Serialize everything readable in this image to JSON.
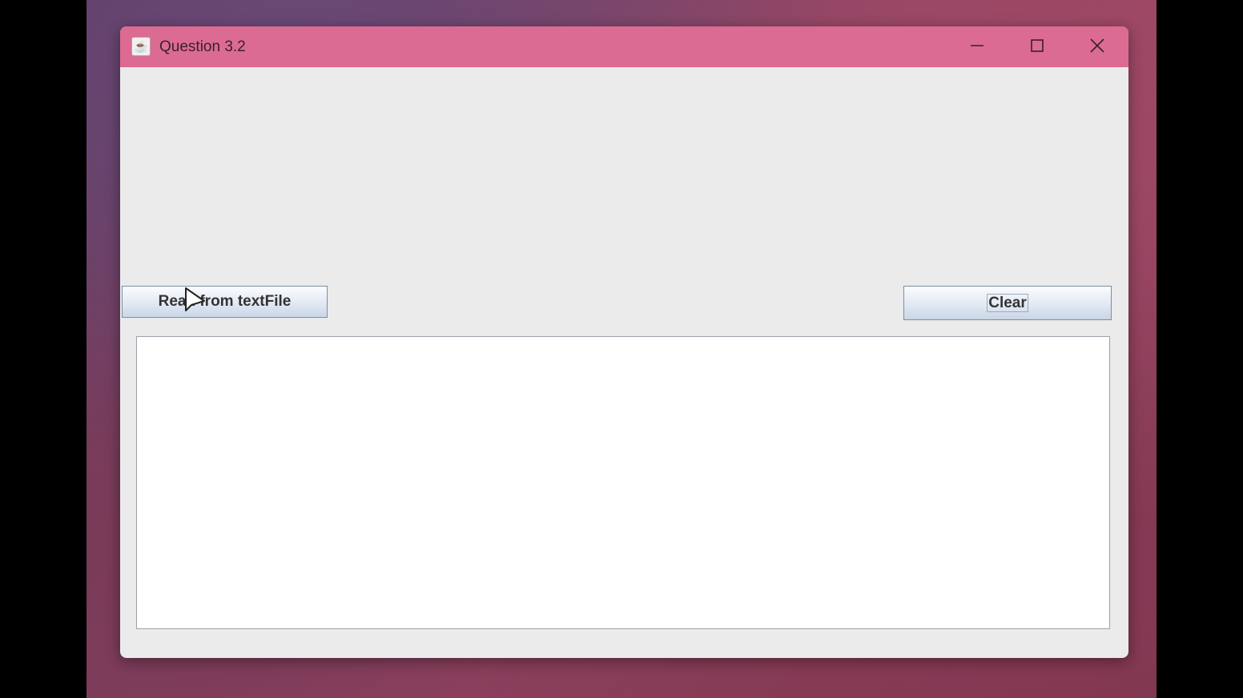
{
  "window": {
    "title": "Question 3.2",
    "icon": "java-coffee-icon",
    "controls": {
      "minimize": "minimize-icon",
      "maximize": "maximize-icon",
      "close": "close-icon"
    },
    "titlebar_color": "#dc6b94"
  },
  "buttons": {
    "read_label": "Read from textFile",
    "clear_label": "Clear"
  },
  "textarea": {
    "value": ""
  }
}
